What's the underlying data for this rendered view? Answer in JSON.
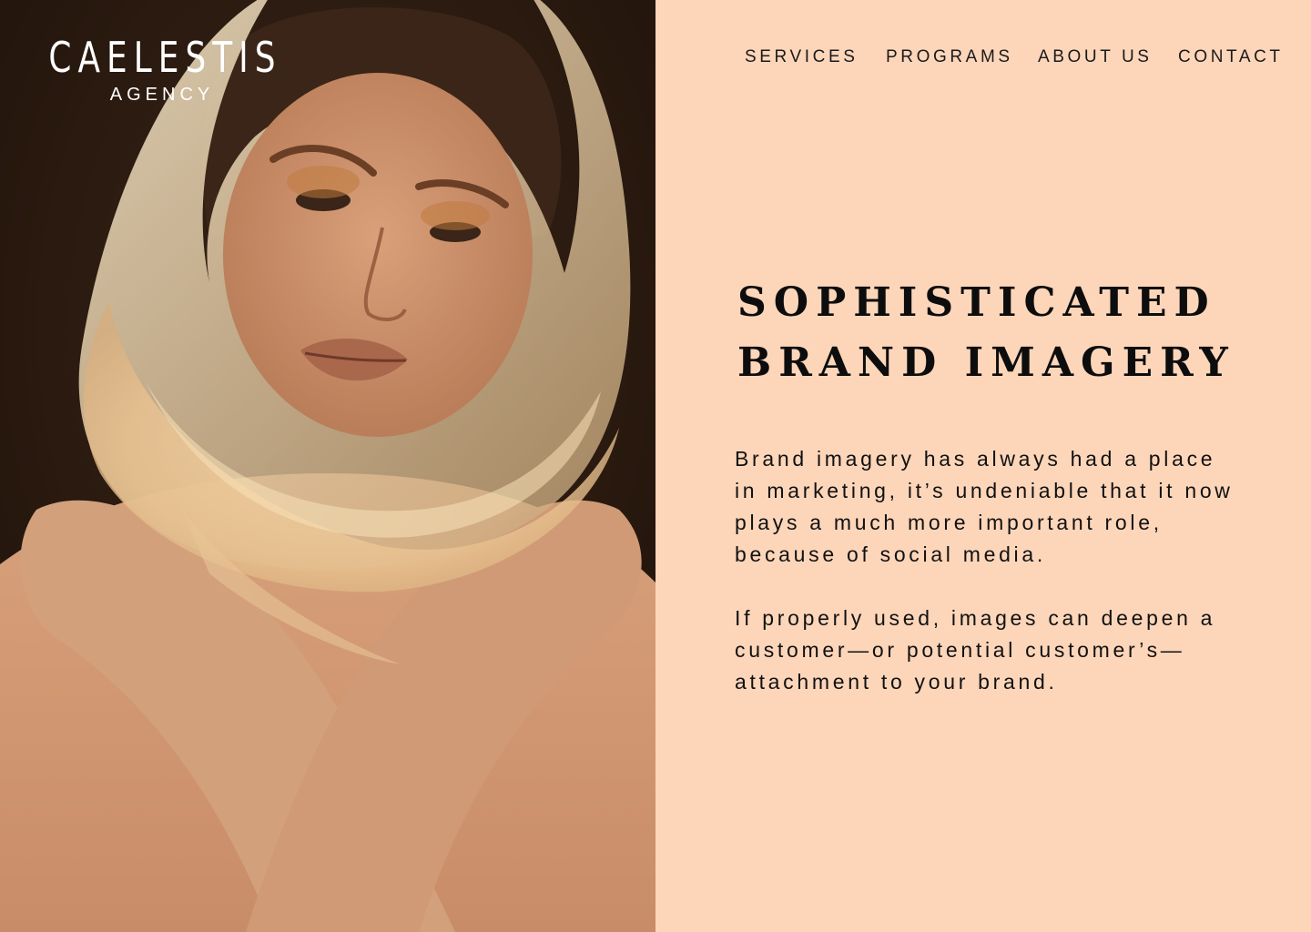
{
  "brand": {
    "name": "CAELESTIS",
    "tagline": "AGENCY"
  },
  "nav": {
    "items": [
      {
        "label": "SERVICES"
      },
      {
        "label": "PROGRAMS"
      },
      {
        "label": "ABOUT US"
      },
      {
        "label": "CONTACT"
      }
    ]
  },
  "hero": {
    "headline_line1": "SOPHISTICATED",
    "headline_line2": "BRAND IMAGERY",
    "paragraph1": "Brand imagery has always had a place in marketing, it’s undeniable that it now plays a much more important role, because of social media.",
    "paragraph2": "If properly used, images can deepen a customer—or potential customer’s—attachment to your brand."
  },
  "image": {
    "subject": "portrait-photo"
  },
  "colors": {
    "panel_background": "#FDD6BA",
    "photo_background": "#2A1A10",
    "text": "#111111",
    "brand_text": "#FFFFFF"
  }
}
